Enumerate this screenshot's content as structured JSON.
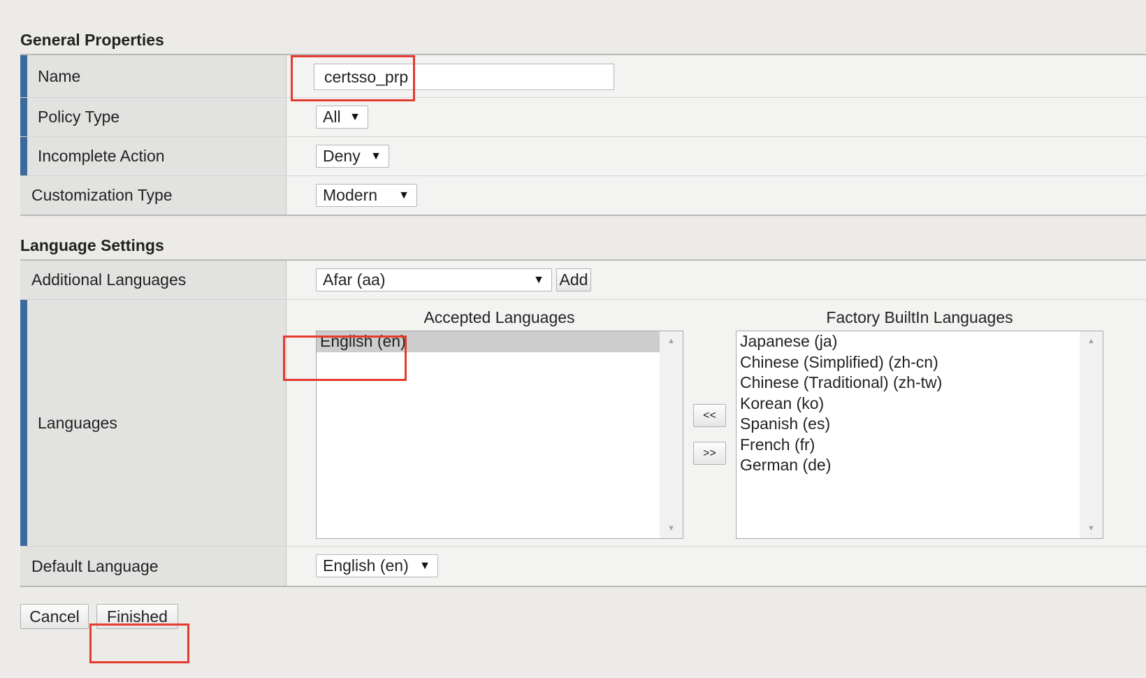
{
  "general": {
    "title": "General Properties",
    "name_label": "Name",
    "name_value": "certsso_prp",
    "policy_type_label": "Policy Type",
    "policy_type_value": "All",
    "incomplete_action_label": "Incomplete Action",
    "incomplete_action_value": "Deny",
    "customization_type_label": "Customization Type",
    "customization_type_value": "Modern"
  },
  "language": {
    "title": "Language Settings",
    "additional_label": "Additional Languages",
    "additional_value": "Afar (aa)",
    "add_button": "Add",
    "languages_label": "Languages",
    "accepted_heading": "Accepted Languages",
    "accepted": [
      "English (en)"
    ],
    "factory_heading": "Factory BuiltIn Languages",
    "factory": [
      "Japanese (ja)",
      "Chinese (Simplified) (zh-cn)",
      "Chinese (Traditional) (zh-tw)",
      "Korean (ko)",
      "Spanish (es)",
      "French (fr)",
      "German (de)"
    ],
    "move_left_button": "<<",
    "move_right_button": ">>",
    "default_label": "Default Language",
    "default_value": "English (en)"
  },
  "actions": {
    "cancel": "Cancel",
    "finished": "Finished"
  },
  "icons": {
    "dropdown": "chevron-down-icon",
    "scroll_up": "scroll-up-icon",
    "scroll_down": "scroll-down-icon"
  },
  "colors": {
    "required_marker": "#3c6a9b",
    "highlight": "#e53a2f"
  }
}
